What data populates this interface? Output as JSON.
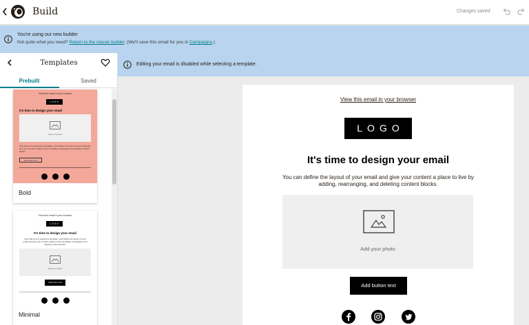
{
  "header": {
    "back_glyph": "‹",
    "title": "Build",
    "status": "Changes saved",
    "icons": [
      "mailchimp-logo-icon",
      "undo-icon",
      "redo-icon"
    ]
  },
  "banner": {
    "title": "You're using our new builder",
    "subtitle_prefix": "Not quite what you need? ",
    "subtitle_link1": "Return to the classic builder",
    "subtitle_middle": ". (We'll save this email for you in ",
    "subtitle_link2": "Campaigns",
    "subtitle_suffix": ".)"
  },
  "sidebar": {
    "back_glyph": "‹",
    "title": "Templates",
    "tabs": [
      {
        "label": "Prebuilt",
        "active": true
      },
      {
        "label": "Saved",
        "active": false
      }
    ],
    "templates": [
      {
        "name": "Bold",
        "preview": {
          "view_link": "View this email in your browser",
          "logo": "LOGO",
          "heading": "It's time to design your email",
          "photo_label": "Add your photo",
          "body": "Now that you've selected a template, you'll define the layout of your email and give your content a place to live by adding, rearranging, and deleting content blocks.",
          "button": "Add button text"
        }
      },
      {
        "name": "Minimal",
        "preview": {
          "view_link": "View this email in your browser",
          "logo": "LOGO",
          "heading": "It's time to design your email",
          "body": "Now that you've selected a template, you'll define the layout of your email and give your content a place to live by adding, rearranging, and deleting content blocks.",
          "photo_label": "Add your photo",
          "button": "Add button text"
        }
      }
    ]
  },
  "main": {
    "notice": "Editing your email is disabled while selecting a template.",
    "email": {
      "view_link": "View this email in your browser",
      "logo": "LOGO",
      "heading": "It's time to design your email",
      "body": "You can define the layout of your email and give your content a place to live by adding, rearranging, and deleting content blocks.",
      "photo_label": "Add your photo",
      "button": "Add button text",
      "social": [
        "facebook-icon",
        "instagram-icon",
        "twitter-icon"
      ]
    }
  },
  "colors": {
    "accent": "#007c89",
    "banner_bg": "#b8d4ee",
    "bold_template_bg": "#f3a89a",
    "canvas_bg": "#ececec"
  }
}
